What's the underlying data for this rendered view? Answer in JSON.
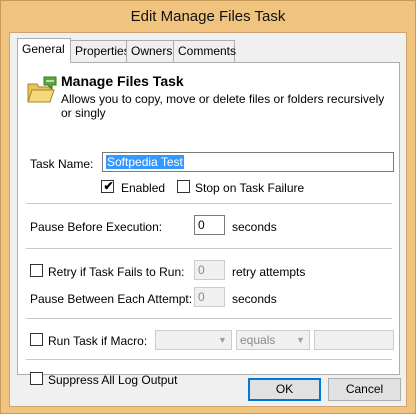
{
  "window": {
    "title": "Edit Manage Files Task"
  },
  "tabs": [
    {
      "label": "General",
      "active": true
    },
    {
      "label": "Properties",
      "active": false
    },
    {
      "label": "Owners",
      "active": false
    },
    {
      "label": "Comments",
      "active": false
    }
  ],
  "task": {
    "heading": "Manage Files Task",
    "description": "Allows you to copy, move or delete files or folders recursively or singly",
    "icon": "folder-copy-icon"
  },
  "form": {
    "task_name_label": "Task Name:",
    "task_name_value": "Softpedia Test",
    "enabled_label": "Enabled",
    "enabled_checked": true,
    "stop_on_failure_label": "Stop on Task Failure",
    "stop_on_failure_checked": false,
    "pause_before_label": "Pause Before Execution:",
    "pause_before_value": "0",
    "pause_before_unit": "seconds",
    "retry_label": "Retry if Task Fails to Run:",
    "retry_checked": false,
    "retry_value": "0",
    "retry_unit": "retry attempts",
    "pause_between_label": "Pause Between Each Attempt:",
    "pause_between_value": "0",
    "pause_between_unit": "seconds",
    "run_if_macro_label": "Run Task if Macro:",
    "run_if_macro_checked": false,
    "macro_value": "",
    "operator_value": "equals",
    "compare_value": "",
    "suppress_log_label": "Suppress All Log Output",
    "suppress_log_checked": false
  },
  "buttons": {
    "ok": "OK",
    "cancel": "Cancel"
  },
  "colors": {
    "titlebar": "#f0c47f",
    "selection": "#3399ff",
    "default_button_border": "#0078d7"
  }
}
